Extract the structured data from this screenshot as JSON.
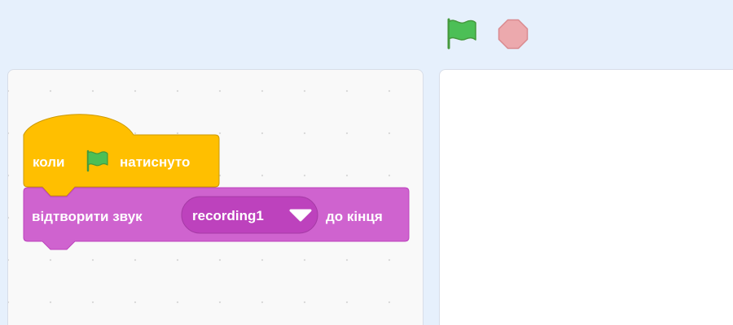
{
  "toolbar": {
    "green_flag_icon": "green-flag-icon",
    "stop_icon": "stop-icon",
    "flag_color": "#4cbf56",
    "stop_color": "#eca9ad"
  },
  "script": {
    "hat_block": {
      "prefix": "коли",
      "icon": "green-flag-icon",
      "suffix": "натиснуто",
      "color": "#ffbf00",
      "border_color": "#cc9900"
    },
    "sound_block": {
      "prefix": "відтворити звук",
      "sound_value": "recording1",
      "dropdown_icon": "dropdown-arrow-icon",
      "suffix": "до кінця",
      "color": "#cf63cf",
      "border_color": "#bd42bd"
    }
  }
}
